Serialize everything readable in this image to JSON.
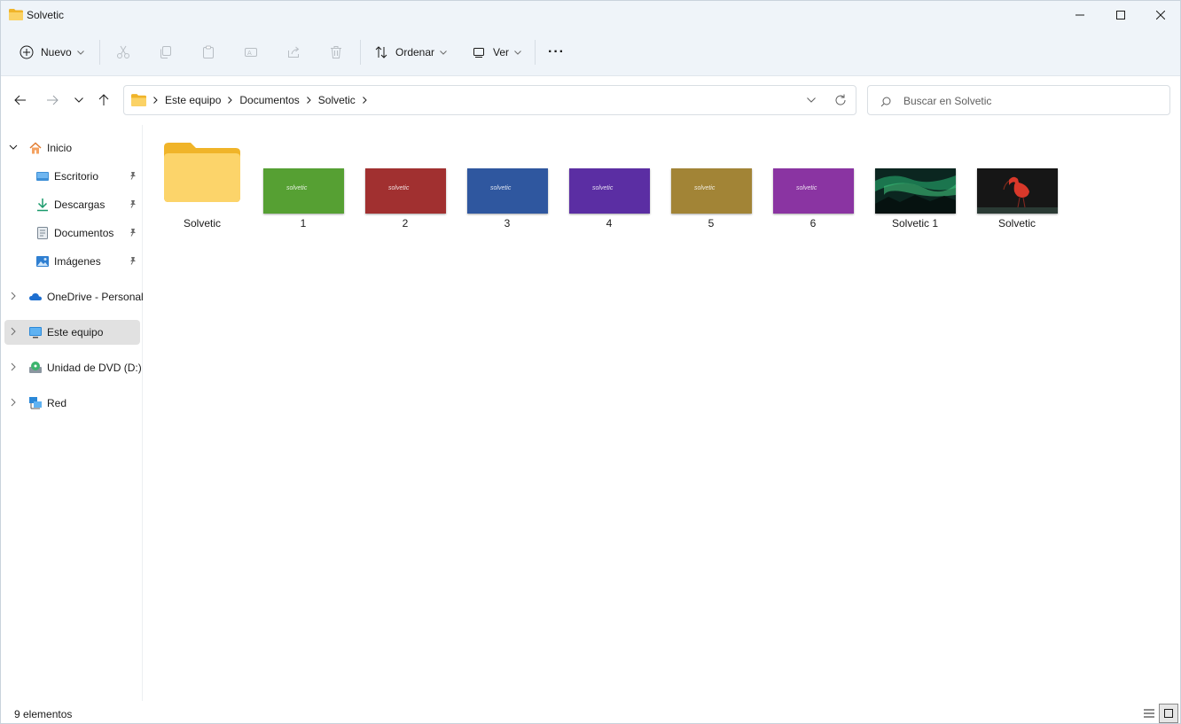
{
  "window": {
    "title": "Solvetic"
  },
  "commandbar": {
    "new_label": "Nuevo",
    "sort_label": "Ordenar",
    "view_label": "Ver",
    "more_label": "···"
  },
  "address": {
    "crumbs": [
      "Este equipo",
      "Documentos",
      "Solvetic"
    ]
  },
  "search": {
    "placeholder": "Buscar en Solvetic"
  },
  "sidebar": {
    "items": [
      {
        "label": "Inicio",
        "icon": "home-icon"
      },
      {
        "label": "Escritorio",
        "icon": "desktop-icon",
        "pinned": true
      },
      {
        "label": "Descargas",
        "icon": "download-icon",
        "pinned": true
      },
      {
        "label": "Documentos",
        "icon": "documents-icon",
        "pinned": true
      },
      {
        "label": "Imágenes",
        "icon": "pictures-icon",
        "pinned": true
      },
      {
        "label": "OneDrive - Personal",
        "icon": "cloud-icon"
      },
      {
        "label": "Este equipo",
        "icon": "computer-icon",
        "selected": true
      },
      {
        "label": "Unidad de DVD (D:)",
        "icon": "dvd-icon"
      },
      {
        "label": "Red",
        "icon": "network-icon"
      }
    ]
  },
  "files": [
    {
      "name": "Solvetic",
      "type": "folder"
    },
    {
      "name": "1",
      "type": "image",
      "color": "#56a033",
      "logo": "solvetic"
    },
    {
      "name": "2",
      "type": "image",
      "color": "#a13030",
      "logo": "solvetic"
    },
    {
      "name": "3",
      "type": "image",
      "color": "#2f579f",
      "logo": "solvetic"
    },
    {
      "name": "4",
      "type": "image",
      "color": "#5b2ea3",
      "logo": "solvetic"
    },
    {
      "name": "5",
      "type": "image",
      "color": "#a28436",
      "logo": "solvetic"
    },
    {
      "name": "6",
      "type": "image",
      "color": "#8a34a2",
      "logo": "solvetic"
    },
    {
      "name": "Solvetic 1",
      "type": "photo",
      "color": "#0e3b2c"
    },
    {
      "name": "Solvetic",
      "type": "photo",
      "color": "#1a1a1a"
    }
  ],
  "status": {
    "count_text": "9 elementos"
  },
  "colors": {
    "titlebar": "#eff4f9",
    "folder": "#f8c94a",
    "selected": "#e1e1e1"
  }
}
